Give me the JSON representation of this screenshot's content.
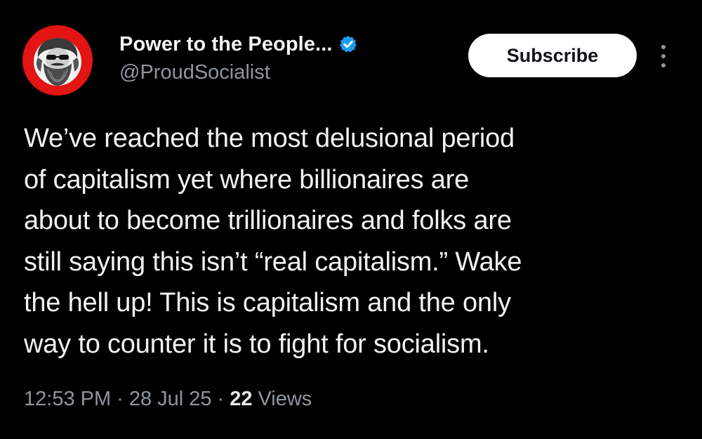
{
  "account": {
    "display_name": "Power to the People...",
    "handle": "@ProudSocialist",
    "verified": true,
    "avatar_icon": "bearded-portrait-icon",
    "avatar_color": "#e21414"
  },
  "actions": {
    "subscribe_label": "Subscribe",
    "more_icon": "more-vertical-icon"
  },
  "post": {
    "text": "We’ve reached the most delusional period\nof capitalism yet where billionaires are\nabout to become trillionaires and folks are\nstill saying this isn’t “real capitalism.” Wake\nthe hell up! This is capitalism and the only\nway to counter it is to fight for socialism."
  },
  "meta": {
    "time": "12:53 PM",
    "separator": "·",
    "date": "28 Jul 25",
    "views_count": "22",
    "views_label": "Views"
  },
  "colors": {
    "background": "#000000",
    "verified_badge": "#1d9bf0",
    "muted_text": "#8f969d"
  }
}
